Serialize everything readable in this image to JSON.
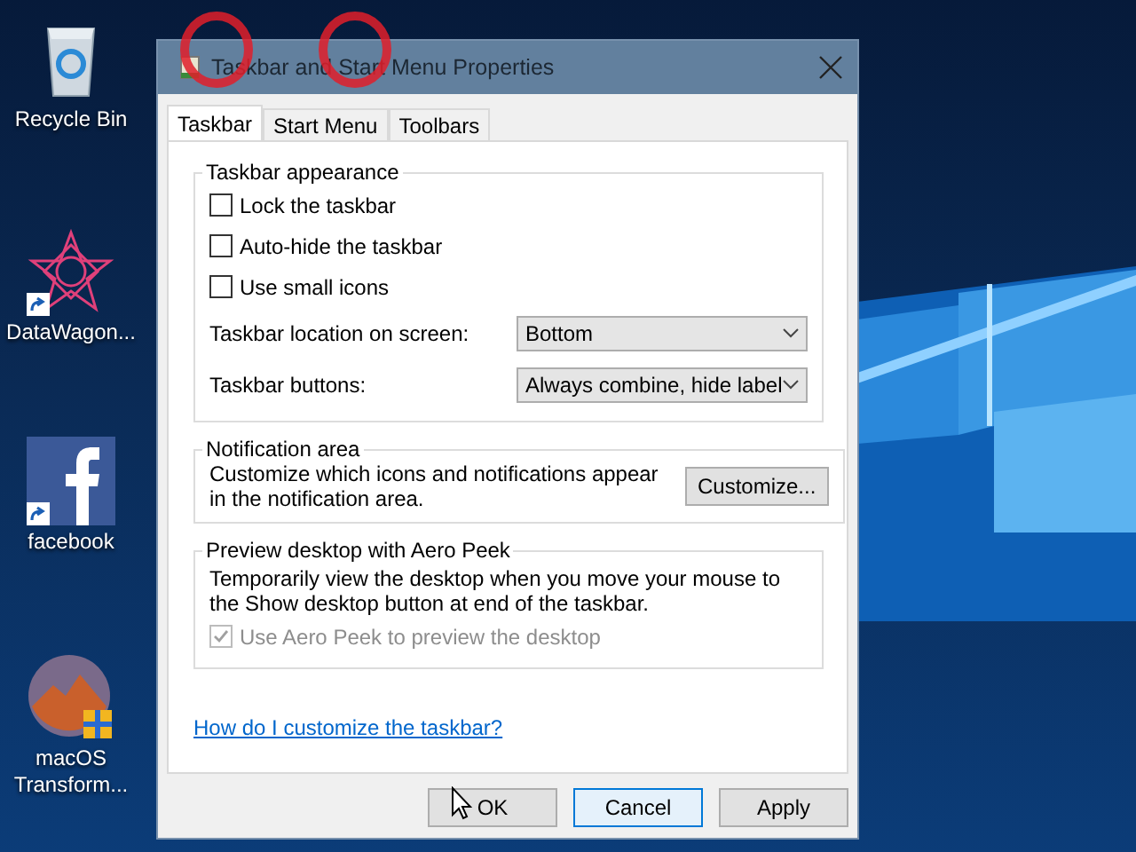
{
  "desktop_icons": [
    {
      "label": "Recycle Bin",
      "kind": "recycle",
      "shortcut": false
    },
    {
      "label": "DataWagon...",
      "kind": "star",
      "shortcut": true
    },
    {
      "label": "facebook",
      "kind": "facebook",
      "shortcut": true
    },
    {
      "label": "macOS Transform...",
      "kind": "macos",
      "shortcut": false
    }
  ],
  "window": {
    "title": "Taskbar and Start Menu Properties"
  },
  "tabs": [
    {
      "label": "Taskbar",
      "selected": true
    },
    {
      "label": "Start Menu",
      "selected": false
    },
    {
      "label": "Toolbars",
      "selected": false
    }
  ],
  "appearance": {
    "title": "Taskbar appearance",
    "options": [
      {
        "label": "Lock the taskbar",
        "checked": false
      },
      {
        "label": "Auto-hide the taskbar",
        "checked": false
      },
      {
        "label": "Use small icons",
        "checked": false
      }
    ],
    "selects": [
      {
        "label": "Taskbar location on screen:",
        "value": "Bottom"
      },
      {
        "label": "Taskbar buttons:",
        "value": "Always combine, hide label"
      }
    ]
  },
  "notification": {
    "title": "Notification area",
    "text": "Customize which icons and notifications appear in the notification area.",
    "button": "Customize..."
  },
  "aero_peek": {
    "title": "Preview desktop with Aero Peek",
    "text": "Temporarily view the desktop when you move your mouse to the Show desktop button at end of the taskbar.",
    "option": {
      "label": "Use Aero Peek to preview the desktop",
      "checked": true,
      "disabled": true
    }
  },
  "help_link": "How do I customize the taskbar?",
  "buttons": [
    {
      "label": "OK",
      "selected": false
    },
    {
      "label": "Cancel",
      "selected": true
    },
    {
      "label": "Apply",
      "selected": false
    }
  ]
}
